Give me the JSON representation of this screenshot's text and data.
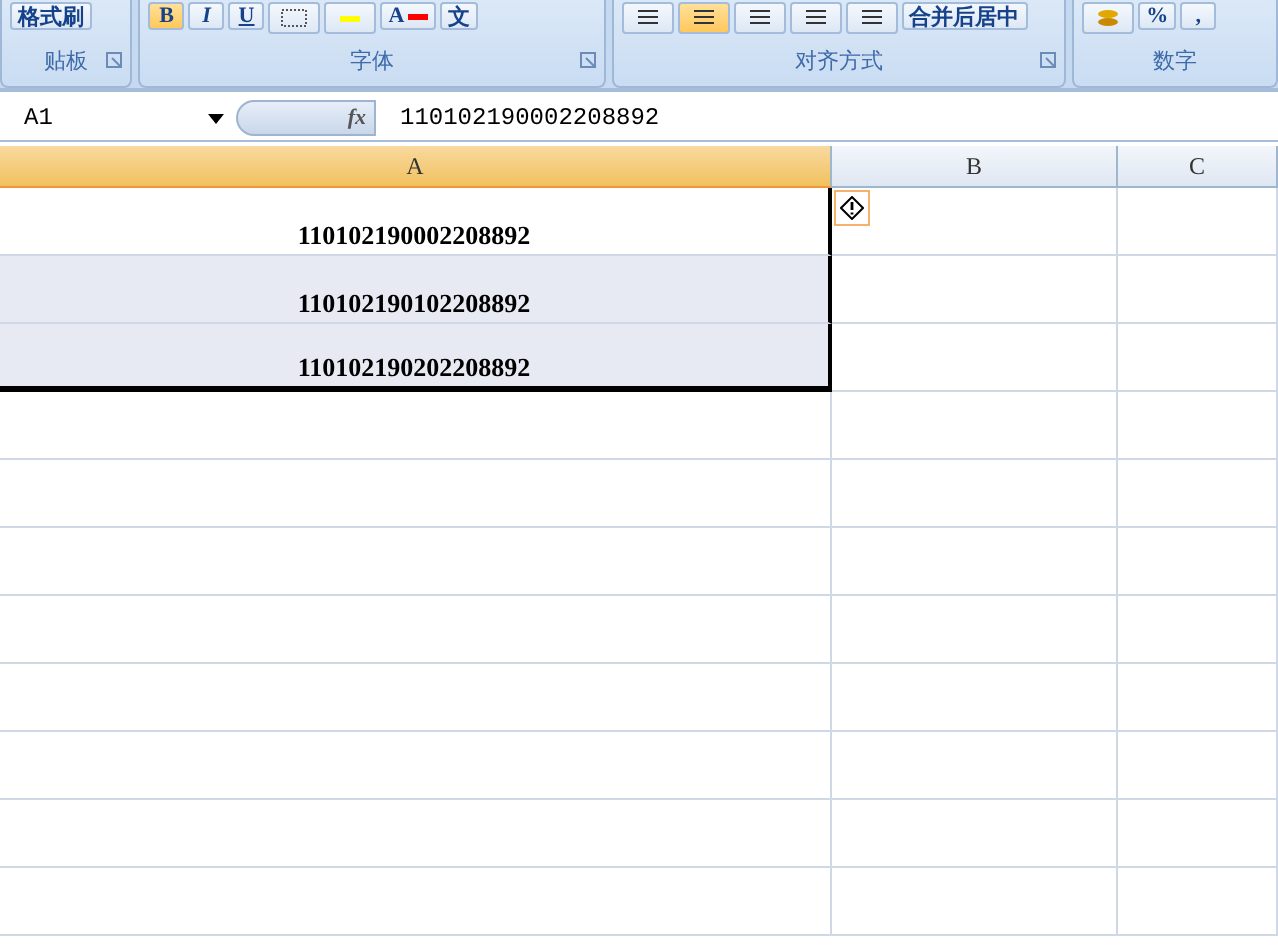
{
  "ribbon": {
    "groups": [
      {
        "label": "贴板",
        "buttons": [
          {
            "kind": "text",
            "label": "格式刷",
            "selected": false
          }
        ]
      },
      {
        "label": "字体",
        "buttons": [
          {
            "kind": "bold",
            "label": "B",
            "selected": true
          },
          {
            "kind": "italic",
            "label": "I",
            "selected": false
          },
          {
            "kind": "underline",
            "label": "U",
            "selected": false
          },
          {
            "kind": "border",
            "selected": false
          },
          {
            "kind": "fill",
            "color": "#ffff00",
            "selected": false
          },
          {
            "kind": "fontcolor",
            "label": "A",
            "color": "#ff0000",
            "selected": false
          },
          {
            "kind": "text",
            "label": "文",
            "selected": false
          }
        ]
      },
      {
        "label": "对齐方式",
        "buttons": [
          {
            "kind": "align",
            "selected": false
          },
          {
            "kind": "align",
            "selected": true
          },
          {
            "kind": "align",
            "selected": false
          },
          {
            "kind": "indent",
            "selected": false
          },
          {
            "kind": "indent",
            "selected": false
          },
          {
            "kind": "text",
            "label": "合并后居中",
            "selected": false
          }
        ]
      },
      {
        "label": "数字",
        "buttons": [
          {
            "kind": "currency",
            "selected": false
          },
          {
            "kind": "text",
            "label": "%",
            "selected": false
          },
          {
            "kind": "text",
            "label": ",",
            "selected": false
          }
        ]
      }
    ]
  },
  "formula_bar": {
    "name_box": "A1",
    "fx": "fx",
    "value": "110102190002208892"
  },
  "columns": [
    {
      "label": "A",
      "selected": true
    },
    {
      "label": "B",
      "selected": false
    },
    {
      "label": "C",
      "selected": false
    }
  ],
  "rows": [
    {
      "cells": [
        {
          "kind": "active",
          "text": "110102190002208892"
        },
        {
          "kind": "warning"
        },
        {
          "kind": "plain"
        }
      ]
    },
    {
      "cells": [
        {
          "kind": "selected",
          "text": "110102190102208892"
        },
        {
          "kind": "plain"
        },
        {
          "kind": "plain"
        }
      ]
    },
    {
      "cells": [
        {
          "kind": "selected",
          "text": "110102190202208892"
        },
        {
          "kind": "plain"
        },
        {
          "kind": "plain"
        }
      ]
    },
    {
      "cells": [
        {
          "kind": "plain"
        },
        {
          "kind": "plain"
        },
        {
          "kind": "plain"
        }
      ]
    },
    {
      "cells": [
        {
          "kind": "plain"
        },
        {
          "kind": "plain"
        },
        {
          "kind": "plain"
        }
      ]
    },
    {
      "cells": [
        {
          "kind": "plain"
        },
        {
          "kind": "plain"
        },
        {
          "kind": "plain"
        }
      ]
    },
    {
      "cells": [
        {
          "kind": "plain"
        },
        {
          "kind": "plain"
        },
        {
          "kind": "plain"
        }
      ]
    },
    {
      "cells": [
        {
          "kind": "plain"
        },
        {
          "kind": "plain"
        },
        {
          "kind": "plain"
        }
      ]
    },
    {
      "cells": [
        {
          "kind": "plain"
        },
        {
          "kind": "plain"
        },
        {
          "kind": "plain"
        }
      ]
    },
    {
      "cells": [
        {
          "kind": "plain"
        },
        {
          "kind": "plain"
        },
        {
          "kind": "plain"
        }
      ]
    },
    {
      "cells": [
        {
          "kind": "plain"
        },
        {
          "kind": "plain"
        },
        {
          "kind": "plain"
        }
      ]
    }
  ]
}
